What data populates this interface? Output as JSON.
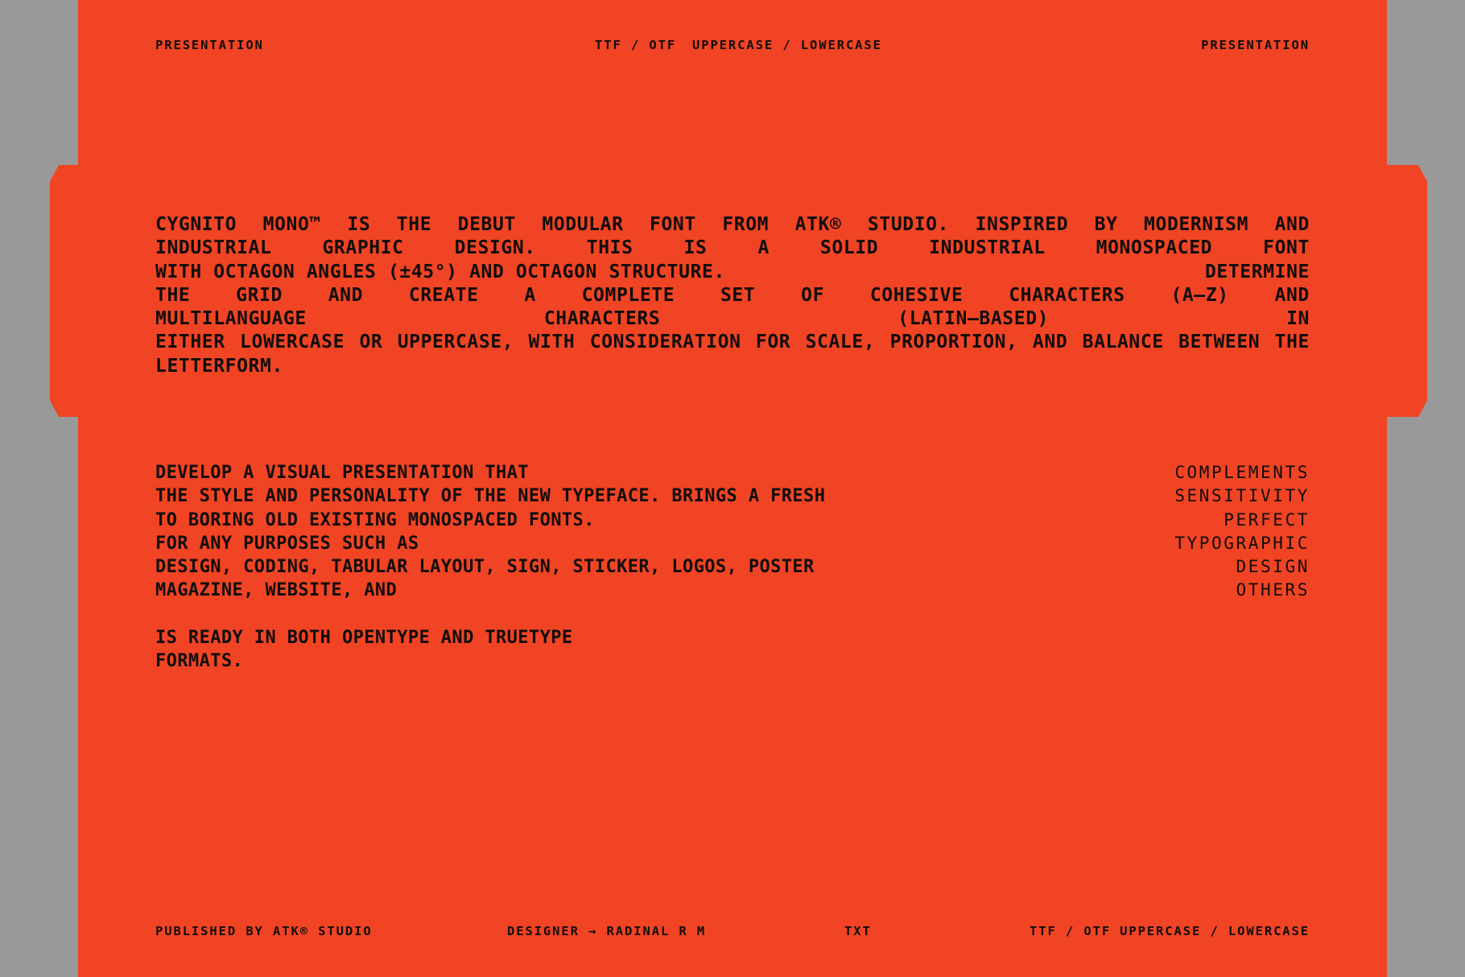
{
  "theme": {
    "page_background": "#999999",
    "sheet_color": "#F04424",
    "ink_color": "#120D0B"
  },
  "header": {
    "left_label": "PRESENTATION",
    "format_label": "TTF / OTF",
    "case_label": "UPPERCASE / LOWERCASE",
    "right_label": "PRESENTATION"
  },
  "hero": {
    "lines": [
      {
        "mode": "justify",
        "words": [
          "CYGNITO",
          "MONO™",
          "IS",
          "THE",
          "DEBUT",
          "MODULAR",
          "FONT",
          "FROM",
          "ATK®",
          "STUDIO.",
          "INSPIRED",
          "BY",
          "MODERNISM",
          "AND"
        ]
      },
      {
        "mode": "justify",
        "words": [
          "INDUSTRIAL",
          "GRAPHIC",
          "DESIGN.",
          "THIS",
          "IS",
          "A",
          "SOLID",
          "INDUSTRIAL",
          "MONOSPACED",
          "FONT"
        ]
      },
      {
        "mode": "split",
        "left": "WITH OCTAGON ANGLES (±45°) AND OCTAGON STRUCTURE.",
        "right": "DETERMINE"
      },
      {
        "mode": "justify",
        "words": [
          "THE",
          "GRID",
          "AND",
          "CREATE",
          "A",
          "COMPLETE",
          "SET",
          "OF",
          "COHESIVE",
          "CHARACTERS",
          "(A–Z)",
          "AND"
        ]
      },
      {
        "mode": "justify",
        "words": [
          "MULTILANGUAGE",
          "CHARACTERS",
          "(LATIN–BASED)",
          "IN"
        ]
      },
      {
        "mode": "justify",
        "words": [
          "EITHER",
          "LOWERCASE",
          "OR",
          "UPPERCASE,",
          "WITH",
          "CONSIDERATION",
          "FOR",
          "SCALE,",
          "PROPORTION,",
          "AND",
          "BALANCE",
          "BETWEEN",
          "THE"
        ]
      },
      {
        "mode": "flow",
        "text": "LETTERFORM."
      }
    ]
  },
  "body": {
    "rows": [
      {
        "left": "DEVELOP A VISUAL PRESENTATION THAT",
        "right": "COMPLEMENTS"
      },
      {
        "left": "THE STYLE AND PERSONALITY OF THE NEW TYPEFACE. BRINGS A FRESH",
        "right": "SENSITIVITY"
      },
      {
        "left": "TO BORING OLD EXISTING MONOSPACED FONTS.",
        "right": "PERFECT"
      },
      {
        "left": "FOR ANY PURPOSES SUCH AS",
        "right": "TYPOGRAPHIC"
      },
      {
        "left": "DESIGN, CODING, TABULAR LAYOUT, SIGN, STICKER, LOGOS, POSTER",
        "right": "DESIGN"
      },
      {
        "left": "MAGAZINE, WEBSITE, AND",
        "right": "OTHERS"
      }
    ],
    "closing": [
      "IS READY IN BOTH OPENTYPE AND TRUETYPE",
      "FORMATS."
    ]
  },
  "footer": {
    "published_label": "PUBLISHED BY ATK® STUDIO",
    "designer_label": "DESIGNER → RADINAL R M",
    "txt_label": "TXT",
    "format_label": "TTF / OTF",
    "case_label": "UPPERCASE / LOWERCASE"
  }
}
